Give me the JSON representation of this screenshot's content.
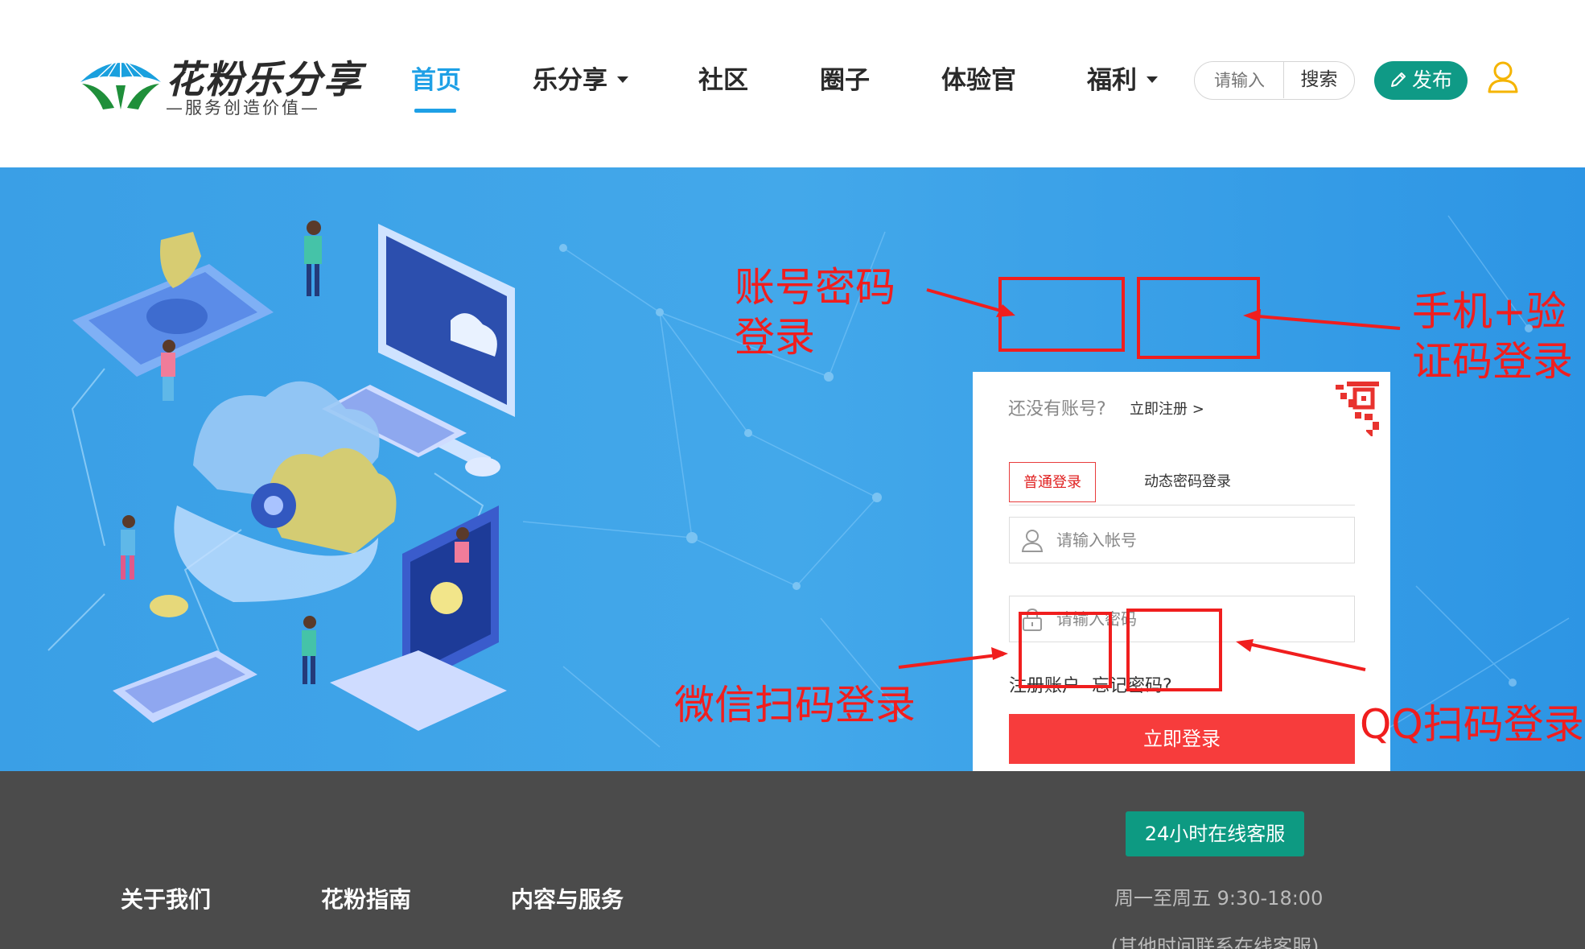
{
  "header": {
    "logo": {
      "name": "花粉乐分享",
      "slogan": "—服务创造价值—"
    },
    "nav": [
      {
        "label": "首页",
        "active": true
      },
      {
        "label": "乐分享",
        "dropdown": true
      },
      {
        "label": "社区"
      },
      {
        "label": "圈子"
      },
      {
        "label": "体验官"
      },
      {
        "label": "福利",
        "dropdown": true
      }
    ],
    "search": {
      "placeholder": "请输入",
      "button_label": "搜索"
    },
    "publish_label": "发布",
    "user_icon": "user-icon"
  },
  "login": {
    "register_prompt": "还没有账号?",
    "register_link": "立即注册 >",
    "qr_icon": "qr-code-corner-icon",
    "tabs": [
      {
        "label": "普通登录",
        "active": true
      },
      {
        "label": "动态密码登录"
      }
    ],
    "account_placeholder": "请输入帐号",
    "password_placeholder": "请输入密码",
    "register_account": "注册账户",
    "forgot_password": "忘记密码?",
    "login_button": "立即登录",
    "social": [
      {
        "icon": "wechat-icon"
      },
      {
        "icon": "qq-icon"
      }
    ]
  },
  "annotations": {
    "account_login": [
      "账号密码",
      "登录"
    ],
    "phone_login": [
      "手机+验",
      "证码登录"
    ],
    "wechat_login": "微信扫码登录",
    "qq_login": "QQ扫码登录"
  },
  "footer": {
    "links": [
      "关于我们",
      "花粉指南",
      "内容与服务"
    ],
    "service_badge": "24小时在线客服",
    "service_hours": "周一至周五 9:30-18:00",
    "service_note": "(其他时间联系在线客服)"
  },
  "colors": {
    "accent_blue": "#1ea0e6",
    "publish_green": "#0f9a86",
    "login_red": "#f73c3c",
    "annotation_red": "#f01e1e",
    "footer_bg": "#4b4b4b",
    "banner_blue": "#3ea3e8"
  }
}
